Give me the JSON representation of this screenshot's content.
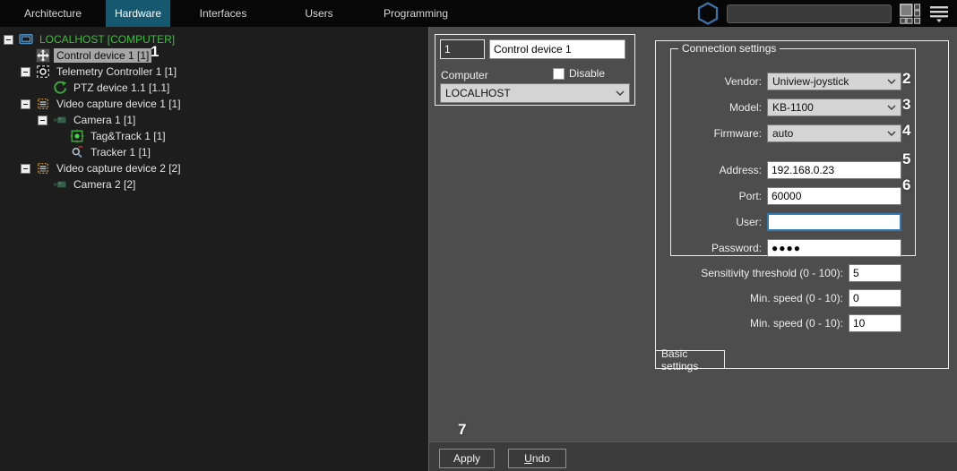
{
  "nav": {
    "tabs": [
      {
        "label": "Architecture",
        "active": false
      },
      {
        "label": "Hardware",
        "active": true
      },
      {
        "label": "Interfaces",
        "active": false
      },
      {
        "label": "Users",
        "active": false
      },
      {
        "label": "Programming",
        "active": false
      }
    ],
    "search": {
      "value": ""
    }
  },
  "colors": {
    "active_tab_bg": "#15586f",
    "tree_root_green": "#3fbf3f",
    "focus_border_blue": "#2e7ab3"
  },
  "tree": {
    "items": [
      {
        "label": "LOCALHOST [COMPUTER]",
        "level": 0,
        "icon": "monitor",
        "expander": true,
        "selected": false,
        "color": "#3fbf3f"
      },
      {
        "label": "Control device 1 [1]",
        "level": 1,
        "icon": "move",
        "expander": false,
        "selected": true
      },
      {
        "label": "Telemetry Controller 1 [1]",
        "level": 1,
        "icon": "aperture",
        "expander": true,
        "selected": false
      },
      {
        "label": "PTZ device 1.1 [1.1]",
        "level": 2,
        "icon": "ptz",
        "expander": false,
        "selected": false
      },
      {
        "label": "Video capture device 1 [1]",
        "level": 1,
        "icon": "capture",
        "expander": true,
        "selected": false
      },
      {
        "label": "Camera 1 [1]",
        "level": 2,
        "icon": "camera",
        "expander": true,
        "selected": false
      },
      {
        "label": "Tag&Track 1 [1]",
        "level": 3,
        "icon": "tagtrack",
        "expander": false,
        "selected": false
      },
      {
        "label": "Tracker 1 [1]",
        "level": 3,
        "icon": "tracker",
        "expander": false,
        "selected": false
      },
      {
        "label": "Video capture device 2 [2]",
        "level": 1,
        "icon": "capture",
        "expander": true,
        "selected": false
      },
      {
        "label": "Camera 2 [2]",
        "level": 2,
        "icon": "camera",
        "expander": false,
        "selected": false
      }
    ]
  },
  "device_form": {
    "id_value": "1",
    "name_value": "Control device 1",
    "computer_label": "Computer",
    "disable_label": "Disable",
    "computer_value": "LOCALHOST"
  },
  "connection": {
    "legend": "Connection settings",
    "vendor_label": "Vendor:",
    "vendor_value": "Uniview-joystick",
    "model_label": "Model:",
    "model_value": "KB-1100",
    "firmware_label": "Firmware:",
    "firmware_value": "auto",
    "address_label": "Address:",
    "address_value": "192.168.0.23",
    "port_label": "Port:",
    "port_value": "60000",
    "user_label": "User:",
    "user_value": "",
    "password_label": "Password:",
    "password_masked": "●●●●"
  },
  "advanced": {
    "sensitivity_label": "Sensitivity threshold (0 - 100):",
    "sensitivity_value": "5",
    "min_speed1_label": "Min. speed (0 - 10):",
    "min_speed1_value": "0",
    "min_speed2_label": "Min. speed (0 - 10):",
    "min_speed2_value": "10"
  },
  "bottom_tabs": {
    "basic_settings": "Basic settings"
  },
  "actions": {
    "apply": "Apply",
    "undo": "Undo"
  },
  "annotations": {
    "n1": "1",
    "n2": "2",
    "n3": "3",
    "n4": "4",
    "n5": "5",
    "n6": "6",
    "n7": "7"
  }
}
